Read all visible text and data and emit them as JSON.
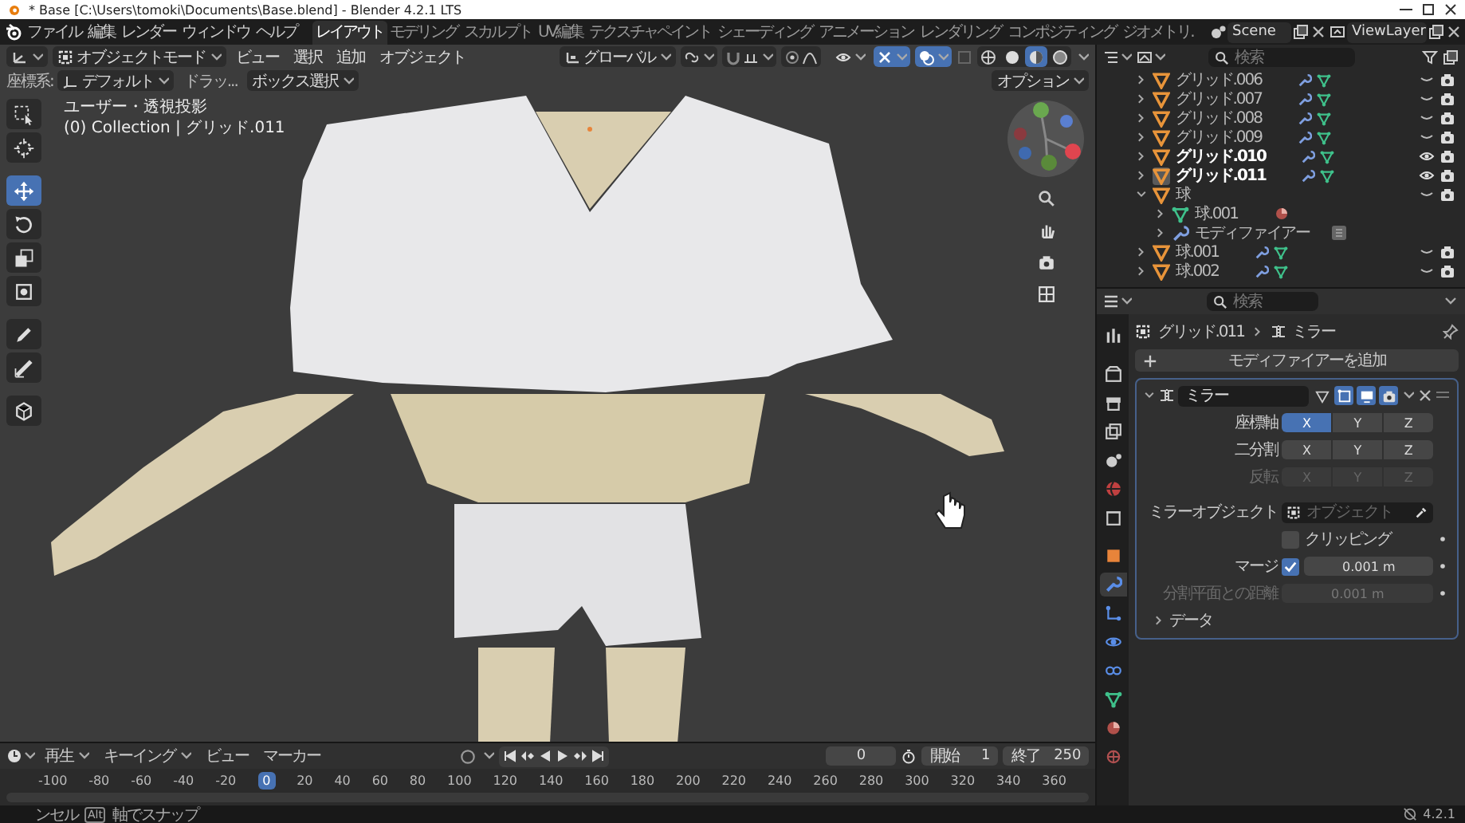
{
  "window": {
    "title": "* Base [C:\\Users\\tomoki\\Documents\\Base.blend] - Blender 4.2.1 LTS"
  },
  "menu_bar": {
    "menus": [
      "ファイル",
      "編集",
      "レンダー",
      "ウィンドウ",
      "ヘルプ"
    ],
    "workspaces": [
      {
        "label": "レイアウト",
        "selected": true
      },
      {
        "label": "モデリング",
        "selected": false
      },
      {
        "label": "スカルプト",
        "selected": false
      },
      {
        "label": "UV編集",
        "selected": false
      },
      {
        "label": "テクスチャペイント",
        "selected": false
      },
      {
        "label": "シェーディング",
        "selected": false
      },
      {
        "label": "アニメーション",
        "selected": false
      },
      {
        "label": "レンダリング",
        "selected": false
      },
      {
        "label": "コンポジティング",
        "selected": false
      },
      {
        "label": "ジオメトリ.",
        "selected": false
      }
    ],
    "scene": "Scene",
    "view_layer": "ViewLayer"
  },
  "viewport": {
    "mode": "オブジェクトモード",
    "menus": [
      "ビュー",
      "選択",
      "追加",
      "オブジェクト"
    ],
    "orientation": "グローバル",
    "snap": {
      "on": false
    },
    "proportional_edit": {
      "on": false
    },
    "overlay_toggles": [
      {
        "on": true
      },
      {
        "on": true
      }
    ],
    "shading": [
      {
        "selected": false
      },
      {
        "selected": false
      },
      {
        "selected": true
      },
      {
        "selected": false
      }
    ],
    "coord_label": "座標系:",
    "coord_value": "デフォルト",
    "drag_label": "ドラッ...",
    "select_mode": "ボックス選択",
    "options": "オプション",
    "view_name": "ユーザー・透視投影",
    "view_object": "(0) Collection | グリッド.011",
    "tools": [
      {
        "selected": false
      },
      {
        "selected": false
      },
      {
        "selected": true
      },
      {
        "selected": false
      },
      {
        "selected": false
      },
      {
        "selected": false
      },
      {
        "selected": false
      },
      {
        "selected": false
      },
      {
        "selected": false
      }
    ]
  },
  "outliner": {
    "search_placeholder": "検索",
    "items": [
      {
        "name": "グリッド.006",
        "kind": "object",
        "expanded": false,
        "selected": false,
        "active": false,
        "visible": false
      },
      {
        "name": "グリッド.007",
        "kind": "object",
        "expanded": false,
        "selected": false,
        "active": false,
        "visible": false
      },
      {
        "name": "グリッド.008",
        "kind": "object",
        "expanded": false,
        "selected": false,
        "active": false,
        "visible": false
      },
      {
        "name": "グリッド.009",
        "kind": "object",
        "expanded": false,
        "selected": false,
        "active": false,
        "visible": false
      },
      {
        "name": "グリッド.010",
        "kind": "object",
        "expanded": false,
        "selected": true,
        "active": false,
        "visible": true
      },
      {
        "name": "グリッド.011",
        "kind": "object",
        "expanded": false,
        "selected": true,
        "active": true,
        "visible": true
      },
      {
        "name": "球",
        "kind": "object",
        "expanded": true,
        "selected": false,
        "active": false,
        "visible": false,
        "children": [
          {
            "name": "球.001",
            "kind": "mesh",
            "expanded": false
          },
          {
            "name": "モディファイアー",
            "kind": "modifiers",
            "expanded": false
          }
        ]
      },
      {
        "name": "球.001",
        "kind": "object",
        "expanded": false,
        "selected": false,
        "active": false,
        "visible": false
      },
      {
        "name": "球.002",
        "kind": "object",
        "expanded": false,
        "selected": false,
        "active": false,
        "visible": false
      }
    ]
  },
  "properties": {
    "search_placeholder": "検索",
    "tabs": [
      {
        "selected": false
      },
      {
        "selected": false
      },
      {
        "selected": false
      },
      {
        "selected": false
      },
      {
        "selected": false
      },
      {
        "selected": false
      },
      {
        "selected": false
      },
      {
        "selected": false
      },
      {
        "selected": true
      },
      {
        "selected": false
      },
      {
        "selected": false
      },
      {
        "selected": false
      },
      {
        "selected": false
      },
      {
        "selected": false
      },
      {
        "selected": false
      }
    ],
    "object_name": "グリッド.011",
    "modifier_crumb": "ミラー",
    "add_modifier": "モディファイアーを追加",
    "modifier": {
      "name": "ミラー",
      "expanded": true,
      "toggles": [
        {
          "on": false
        },
        {
          "on": true
        },
        {
          "on": true
        },
        {
          "on": true
        }
      ],
      "axis_rows": [
        {
          "label": "座標軸",
          "disabled": false,
          "axes": [
            {
              "label": "X",
              "selected": true
            },
            {
              "label": "Y",
              "selected": false
            },
            {
              "label": "Z",
              "selected": false
            }
          ]
        },
        {
          "label": "二分割",
          "disabled": false,
          "axes": [
            {
              "label": "X",
              "selected": false
            },
            {
              "label": "Y",
              "selected": false
            },
            {
              "label": "Z",
              "selected": false
            }
          ]
        },
        {
          "label": "反転",
          "disabled": true,
          "axes": [
            {
              "label": "X",
              "selected": false
            },
            {
              "label": "Y",
              "selected": false
            },
            {
              "label": "Z",
              "selected": false
            }
          ]
        }
      ],
      "mirror_object_label": "ミラーオブジェクト",
      "mirror_object_placeholder": "オブジェクト",
      "clipping": {
        "label": "クリッピング",
        "checked": false
      },
      "merge": {
        "label": "マージ",
        "checked": true,
        "value": "0.001 m"
      },
      "bisect": {
        "label": "分割平面との距離",
        "value": "0.001 m",
        "disabled": true
      },
      "data_panel": {
        "label": "データ",
        "expanded": false
      }
    }
  },
  "timeline": {
    "menus": [
      {
        "label": "再生",
        "dropdown": true
      },
      {
        "label": "キーイング",
        "dropdown": true
      },
      {
        "label": "ビュー",
        "dropdown": false
      },
      {
        "label": "マーカー",
        "dropdown": false
      }
    ],
    "current_frame": "0",
    "start_label": "開始",
    "start": "1",
    "end_label": "終了",
    "end": "250",
    "ruler": [
      {
        "label": "-100",
        "current": false
      },
      {
        "label": "-80",
        "current": false
      },
      {
        "label": "-60",
        "current": false
      },
      {
        "label": "-40",
        "current": false
      },
      {
        "label": "-20",
        "current": false
      },
      {
        "label": "0",
        "current": true
      },
      {
        "label": "20",
        "current": false
      },
      {
        "label": "40",
        "current": false
      },
      {
        "label": "60",
        "current": false
      },
      {
        "label": "80",
        "current": false
      },
      {
        "label": "100",
        "current": false
      },
      {
        "label": "120",
        "current": false
      },
      {
        "label": "140",
        "current": false
      },
      {
        "label": "160",
        "current": false
      },
      {
        "label": "180",
        "current": false
      },
      {
        "label": "200",
        "current": false
      },
      {
        "label": "220",
        "current": false
      },
      {
        "label": "240",
        "current": false
      },
      {
        "label": "260",
        "current": false
      },
      {
        "label": "280",
        "current": false
      },
      {
        "label": "300",
        "current": false
      },
      {
        "label": "320",
        "current": false
      },
      {
        "label": "340",
        "current": false
      },
      {
        "label": "360",
        "current": false
      }
    ]
  },
  "status_bar": {
    "hint_1": "ンセル",
    "key": "Alt",
    "hint_2": "軸でスナップ",
    "version": "4.2.1"
  }
}
